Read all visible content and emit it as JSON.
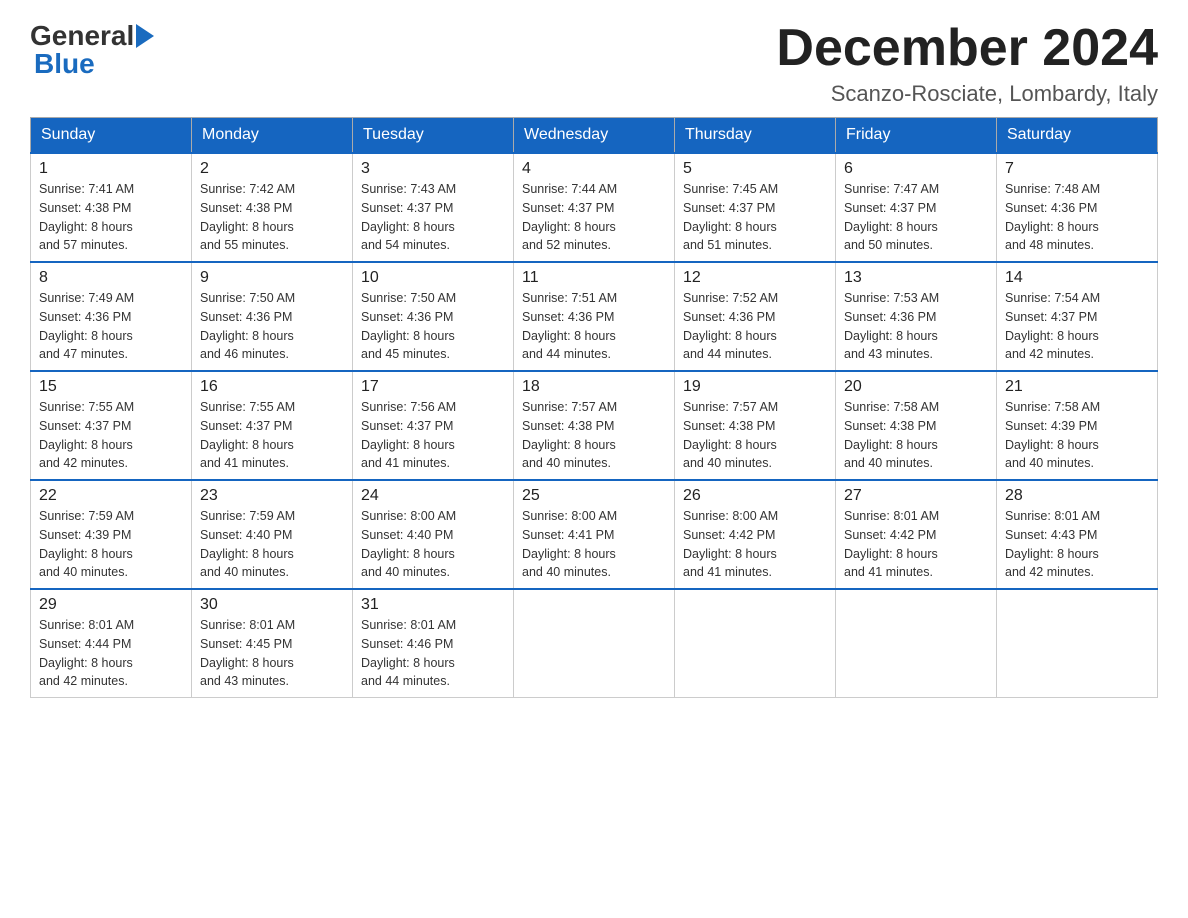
{
  "header": {
    "title": "December 2024",
    "subtitle": "Scanzo-Rosciate, Lombardy, Italy",
    "logo_general": "General",
    "logo_blue": "Blue"
  },
  "days_of_week": [
    "Sunday",
    "Monday",
    "Tuesday",
    "Wednesday",
    "Thursday",
    "Friday",
    "Saturday"
  ],
  "weeks": [
    [
      {
        "day": "1",
        "sunrise": "7:41 AM",
        "sunset": "4:38 PM",
        "daylight": "8 hours and 57 minutes."
      },
      {
        "day": "2",
        "sunrise": "7:42 AM",
        "sunset": "4:38 PM",
        "daylight": "8 hours and 55 minutes."
      },
      {
        "day": "3",
        "sunrise": "7:43 AM",
        "sunset": "4:37 PM",
        "daylight": "8 hours and 54 minutes."
      },
      {
        "day": "4",
        "sunrise": "7:44 AM",
        "sunset": "4:37 PM",
        "daylight": "8 hours and 52 minutes."
      },
      {
        "day": "5",
        "sunrise": "7:45 AM",
        "sunset": "4:37 PM",
        "daylight": "8 hours and 51 minutes."
      },
      {
        "day": "6",
        "sunrise": "7:47 AM",
        "sunset": "4:37 PM",
        "daylight": "8 hours and 50 minutes."
      },
      {
        "day": "7",
        "sunrise": "7:48 AM",
        "sunset": "4:36 PM",
        "daylight": "8 hours and 48 minutes."
      }
    ],
    [
      {
        "day": "8",
        "sunrise": "7:49 AM",
        "sunset": "4:36 PM",
        "daylight": "8 hours and 47 minutes."
      },
      {
        "day": "9",
        "sunrise": "7:50 AM",
        "sunset": "4:36 PM",
        "daylight": "8 hours and 46 minutes."
      },
      {
        "day": "10",
        "sunrise": "7:50 AM",
        "sunset": "4:36 PM",
        "daylight": "8 hours and 45 minutes."
      },
      {
        "day": "11",
        "sunrise": "7:51 AM",
        "sunset": "4:36 PM",
        "daylight": "8 hours and 44 minutes."
      },
      {
        "day": "12",
        "sunrise": "7:52 AM",
        "sunset": "4:36 PM",
        "daylight": "8 hours and 44 minutes."
      },
      {
        "day": "13",
        "sunrise": "7:53 AM",
        "sunset": "4:36 PM",
        "daylight": "8 hours and 43 minutes."
      },
      {
        "day": "14",
        "sunrise": "7:54 AM",
        "sunset": "4:37 PM",
        "daylight": "8 hours and 42 minutes."
      }
    ],
    [
      {
        "day": "15",
        "sunrise": "7:55 AM",
        "sunset": "4:37 PM",
        "daylight": "8 hours and 42 minutes."
      },
      {
        "day": "16",
        "sunrise": "7:55 AM",
        "sunset": "4:37 PM",
        "daylight": "8 hours and 41 minutes."
      },
      {
        "day": "17",
        "sunrise": "7:56 AM",
        "sunset": "4:37 PM",
        "daylight": "8 hours and 41 minutes."
      },
      {
        "day": "18",
        "sunrise": "7:57 AM",
        "sunset": "4:38 PM",
        "daylight": "8 hours and 40 minutes."
      },
      {
        "day": "19",
        "sunrise": "7:57 AM",
        "sunset": "4:38 PM",
        "daylight": "8 hours and 40 minutes."
      },
      {
        "day": "20",
        "sunrise": "7:58 AM",
        "sunset": "4:38 PM",
        "daylight": "8 hours and 40 minutes."
      },
      {
        "day": "21",
        "sunrise": "7:58 AM",
        "sunset": "4:39 PM",
        "daylight": "8 hours and 40 minutes."
      }
    ],
    [
      {
        "day": "22",
        "sunrise": "7:59 AM",
        "sunset": "4:39 PM",
        "daylight": "8 hours and 40 minutes."
      },
      {
        "day": "23",
        "sunrise": "7:59 AM",
        "sunset": "4:40 PM",
        "daylight": "8 hours and 40 minutes."
      },
      {
        "day": "24",
        "sunrise": "8:00 AM",
        "sunset": "4:40 PM",
        "daylight": "8 hours and 40 minutes."
      },
      {
        "day": "25",
        "sunrise": "8:00 AM",
        "sunset": "4:41 PM",
        "daylight": "8 hours and 40 minutes."
      },
      {
        "day": "26",
        "sunrise": "8:00 AM",
        "sunset": "4:42 PM",
        "daylight": "8 hours and 41 minutes."
      },
      {
        "day": "27",
        "sunrise": "8:01 AM",
        "sunset": "4:42 PM",
        "daylight": "8 hours and 41 minutes."
      },
      {
        "day": "28",
        "sunrise": "8:01 AM",
        "sunset": "4:43 PM",
        "daylight": "8 hours and 42 minutes."
      }
    ],
    [
      {
        "day": "29",
        "sunrise": "8:01 AM",
        "sunset": "4:44 PM",
        "daylight": "8 hours and 42 minutes."
      },
      {
        "day": "30",
        "sunrise": "8:01 AM",
        "sunset": "4:45 PM",
        "daylight": "8 hours and 43 minutes."
      },
      {
        "day": "31",
        "sunrise": "8:01 AM",
        "sunset": "4:46 PM",
        "daylight": "8 hours and 44 minutes."
      },
      null,
      null,
      null,
      null
    ]
  ],
  "labels": {
    "sunrise": "Sunrise:",
    "sunset": "Sunset:",
    "daylight": "Daylight:"
  },
  "colors": {
    "header_bg": "#1565c0",
    "header_border": "#1565c0"
  }
}
